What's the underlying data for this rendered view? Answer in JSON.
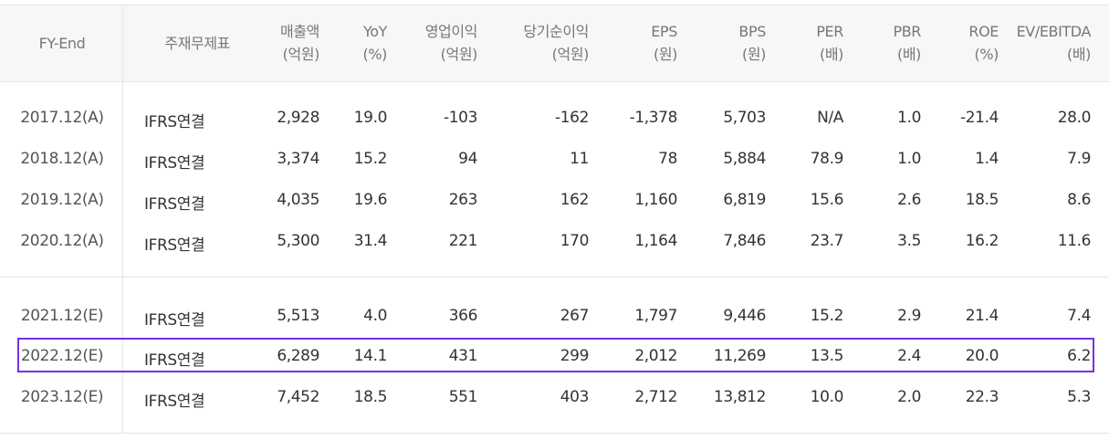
{
  "table": {
    "headers": [
      {
        "label": "FY-End",
        "unit": ""
      },
      {
        "label": "주재무제표",
        "unit": ""
      },
      {
        "label": "매출액",
        "unit": "(억원)"
      },
      {
        "label": "YoY",
        "unit": "(%)"
      },
      {
        "label": "영업이익",
        "unit": "(억원)"
      },
      {
        "label": "당기순이익",
        "unit": "(억원)"
      },
      {
        "label": "EPS",
        "unit": "(원)"
      },
      {
        "label": "BPS",
        "unit": "(원)"
      },
      {
        "label": "PER",
        "unit": "(배)"
      },
      {
        "label": "PBR",
        "unit": "(배)"
      },
      {
        "label": "ROE",
        "unit": "(%)"
      },
      {
        "label": "EV/EBITDA",
        "unit": "(배)"
      }
    ],
    "rows": [
      [
        "2017.12(A)",
        "IFRS연결",
        "2,928",
        "19.0",
        "-103",
        "-162",
        "-1,378",
        "5,703",
        "N/A",
        "1.0",
        "-21.4",
        "28.0"
      ],
      [
        "2018.12(A)",
        "IFRS연결",
        "3,374",
        "15.2",
        "94",
        "11",
        "78",
        "5,884",
        "78.9",
        "1.0",
        "1.4",
        "7.9"
      ],
      [
        "2019.12(A)",
        "IFRS연결",
        "4,035",
        "19.6",
        "263",
        "162",
        "1,160",
        "6,819",
        "15.6",
        "2.6",
        "18.5",
        "8.6"
      ],
      [
        "2020.12(A)",
        "IFRS연결",
        "5,300",
        "31.4",
        "221",
        "170",
        "1,164",
        "7,846",
        "23.7",
        "3.5",
        "16.2",
        "11.6"
      ],
      [
        "2021.12(E)",
        "IFRS연결",
        "5,513",
        "4.0",
        "366",
        "267",
        "1,797",
        "9,446",
        "15.2",
        "2.9",
        "21.4",
        "7.4"
      ],
      [
        "2022.12(E)",
        "IFRS연결",
        "6,289",
        "14.1",
        "431",
        "299",
        "2,012",
        "11,269",
        "13.5",
        "2.4",
        "20.0",
        "6.2"
      ],
      [
        "2023.12(E)",
        "IFRS연결",
        "7,452",
        "18.5",
        "551",
        "403",
        "2,712",
        "13,812",
        "10.0",
        "2.0",
        "22.3",
        "5.3"
      ]
    ],
    "highlighted_row": "2022.12(E)"
  },
  "colors": {
    "highlight_border": "#7a2ee6",
    "header_bg": "#f7f7f7",
    "header_text": "#777777"
  }
}
